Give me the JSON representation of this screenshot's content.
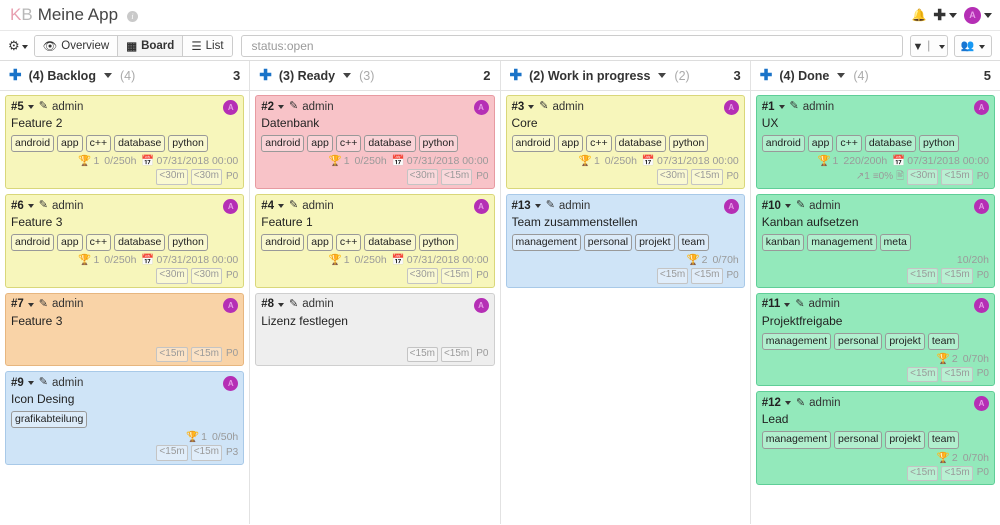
{
  "header": {
    "logo_prefix_k": "K",
    "logo_prefix_b": "B",
    "title": "Meine App",
    "info_icon_char": "i",
    "bell_icon": "bell-icon",
    "plus_icon": "plus-icon",
    "avatar_initial": "A"
  },
  "toolbar": {
    "gear_label": "",
    "overview_label": "Overview",
    "board_label": "Board",
    "list_label": "List",
    "search_value": "status:open",
    "search_placeholder": "status:open",
    "filter_button": "filter-icon",
    "users_button": "users-icon"
  },
  "columns": [
    {
      "title": "(4) Backlog",
      "limit": "(4)",
      "count": "3",
      "cards": [
        {
          "id": "#5",
          "user": "admin",
          "avatar": "A",
          "title": "Feature 2",
          "color": "c-yellow",
          "tags": [
            "android",
            "app",
            "c++",
            "database",
            "python"
          ],
          "score": "1",
          "hours": "0/250h",
          "date": "07/31/2018 00:00",
          "links": "",
          "progress": "",
          "has_description": false,
          "time1": "<30m",
          "time2": "<30m",
          "priority": "P0"
        },
        {
          "id": "#6",
          "user": "admin",
          "avatar": "A",
          "title": "Feature 3",
          "color": "c-yellow",
          "tags": [
            "android",
            "app",
            "c++",
            "database",
            "python"
          ],
          "score": "1",
          "hours": "0/250h",
          "date": "07/31/2018 00:00",
          "links": "",
          "progress": "",
          "has_description": false,
          "time1": "<30m",
          "time2": "<30m",
          "priority": "P0"
        },
        {
          "id": "#7",
          "user": "admin",
          "avatar": "A",
          "title": "Feature 3",
          "color": "c-orange",
          "tags": [],
          "score": "",
          "hours": "",
          "date": "",
          "links": "",
          "progress": "",
          "has_description": false,
          "time1": "<15m",
          "time2": "<15m",
          "priority": "P0"
        },
        {
          "id": "#9",
          "user": "admin",
          "avatar": "A",
          "title": "Icon Desing",
          "color": "c-blue",
          "tags": [
            "grafikabteilung"
          ],
          "score": "1",
          "hours": "0/50h",
          "date": "",
          "links": "",
          "progress": "",
          "has_description": false,
          "time1": "<15m",
          "time2": "<15m",
          "priority": "P3"
        }
      ]
    },
    {
      "title": "(3) Ready",
      "limit": "(3)",
      "count": "2",
      "cards": [
        {
          "id": "#2",
          "user": "admin",
          "avatar": "A",
          "title": "Datenbank",
          "color": "c-pink",
          "tags": [
            "android",
            "app",
            "c++",
            "database",
            "python"
          ],
          "score": "1",
          "hours": "0/250h",
          "date": "07/31/2018 00:00",
          "links": "",
          "progress": "",
          "has_description": false,
          "time1": "<30m",
          "time2": "<15m",
          "priority": "P0"
        },
        {
          "id": "#4",
          "user": "admin",
          "avatar": "A",
          "title": "Feature 1",
          "color": "c-yellow",
          "tags": [
            "android",
            "app",
            "c++",
            "database",
            "python"
          ],
          "score": "1",
          "hours": "0/250h",
          "date": "07/31/2018 00:00",
          "links": "",
          "progress": "",
          "has_description": false,
          "time1": "<30m",
          "time2": "<15m",
          "priority": "P0"
        },
        {
          "id": "#8",
          "user": "admin",
          "avatar": "A",
          "title": "Lizenz festlegen",
          "color": "c-grey",
          "tags": [],
          "score": "",
          "hours": "",
          "date": "",
          "links": "",
          "progress": "",
          "has_description": false,
          "time1": "<15m",
          "time2": "<15m",
          "priority": "P0"
        }
      ]
    },
    {
      "title": "(2) Work in progress",
      "limit": "(2)",
      "count": "3",
      "cards": [
        {
          "id": "#3",
          "user": "admin",
          "avatar": "A",
          "title": "Core",
          "color": "c-yellow",
          "tags": [
            "android",
            "app",
            "c++",
            "database",
            "python"
          ],
          "score": "1",
          "hours": "0/250h",
          "date": "07/31/2018 00:00",
          "links": "",
          "progress": "",
          "has_description": false,
          "time1": "<30m",
          "time2": "<15m",
          "priority": "P0"
        },
        {
          "id": "#13",
          "user": "admin",
          "avatar": "A",
          "title": "Team zusammenstellen",
          "color": "c-wip",
          "tags": [
            "management",
            "personal",
            "projekt",
            "team"
          ],
          "score": "2",
          "hours": "0/70h",
          "date": "",
          "links": "",
          "progress": "",
          "has_description": false,
          "time1": "<15m",
          "time2": "<15m",
          "priority": "P0"
        }
      ]
    },
    {
      "title": "(4) Done",
      "limit": "(4)",
      "count": "5",
      "cards": [
        {
          "id": "#1",
          "user": "admin",
          "avatar": "A",
          "title": "UX",
          "color": "c-green",
          "tags": [
            "android",
            "app",
            "c++",
            "database",
            "python"
          ],
          "score": "1",
          "hours": "220/200h",
          "date": "07/31/2018 00:00",
          "links": "1",
          "progress": "0%",
          "has_description": true,
          "time1": "<30m",
          "time2": "<15m",
          "priority": "P0"
        },
        {
          "id": "#10",
          "user": "admin",
          "avatar": "A",
          "title": "Kanban aufsetzen",
          "color": "c-green",
          "tags": [
            "kanban",
            "management",
            "meta"
          ],
          "score": "",
          "hours": "10/20h",
          "date": "",
          "links": "",
          "progress": "",
          "has_description": false,
          "time1": "<15m",
          "time2": "<15m",
          "priority": "P0"
        },
        {
          "id": "#11",
          "user": "admin",
          "avatar": "A",
          "title": "Projektfreigabe",
          "color": "c-green",
          "tags": [
            "management",
            "personal",
            "projekt",
            "team"
          ],
          "score": "2",
          "hours": "0/70h",
          "date": "",
          "links": "",
          "progress": "",
          "has_description": false,
          "time1": "<15m",
          "time2": "<15m",
          "priority": "P0"
        },
        {
          "id": "#12",
          "user": "admin",
          "avatar": "A",
          "title": "Lead",
          "color": "c-green",
          "tags": [
            "management",
            "personal",
            "projekt",
            "team"
          ],
          "score": "2",
          "hours": "0/70h",
          "date": "",
          "links": "",
          "progress": "",
          "has_description": false,
          "time1": "<15m",
          "time2": "<15m",
          "priority": "P0"
        }
      ]
    }
  ]
}
